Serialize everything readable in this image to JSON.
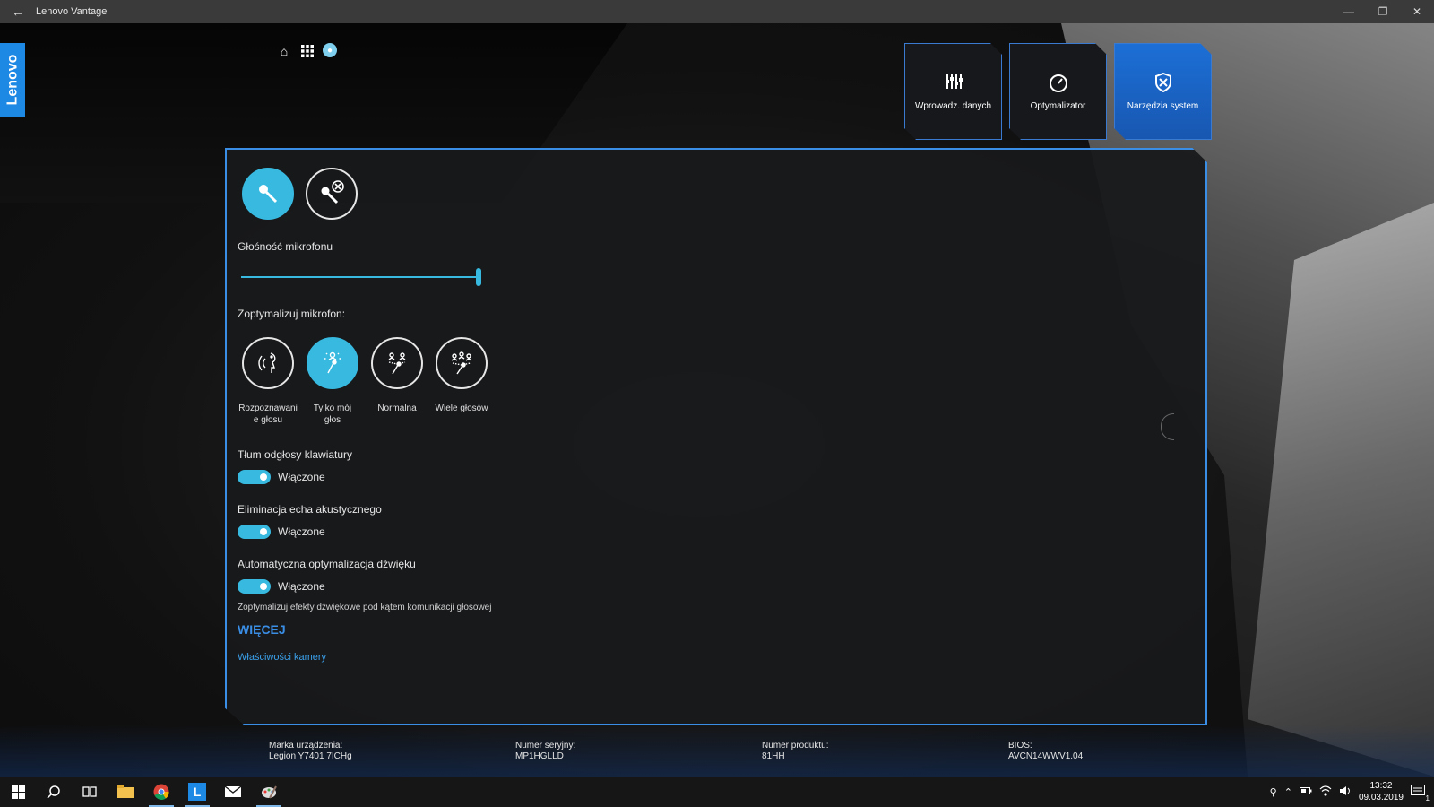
{
  "window": {
    "title": "Lenovo Vantage",
    "back_icon": "arrow-left-icon",
    "controls": [
      "—",
      "❐",
      "✕"
    ]
  },
  "brand": {
    "logo_text": "Lenovo"
  },
  "top_icons": [
    "home-icon",
    "apps-grid-icon",
    "user-icon"
  ],
  "nav_tiles": [
    {
      "label": "Wprowadz. danych",
      "icon": "input-sliders-icon",
      "active": false
    },
    {
      "label": "Optymalizator",
      "icon": "speedometer-icon",
      "active": false
    },
    {
      "label": "Narzędzia system",
      "icon": "tools-shield-icon",
      "active": true
    }
  ],
  "microphone": {
    "mic_buttons": [
      {
        "icon": "microphone-icon",
        "active": true
      },
      {
        "icon": "microphone-mute-icon",
        "active": false
      }
    ],
    "volume_label": "Głośność mikrofonu",
    "volume_value": 100,
    "optimize_label": "Zoptymalizuj mikrofon:",
    "modes": [
      {
        "label": "Rozpoznawani e głosu",
        "icon": "voice-recognition-icon",
        "active": false
      },
      {
        "label": "Tylko mój głos",
        "icon": "only-my-voice-icon",
        "active": true
      },
      {
        "label": "Normalna",
        "icon": "normal-icon",
        "active": false
      },
      {
        "label": "Wiele głosów",
        "icon": "multiple-voices-icon",
        "active": false
      }
    ],
    "toggles": [
      {
        "title": "Tłum odgłosy klawiatury",
        "state": "Włączone"
      },
      {
        "title": "Eliminacja echa akustycznego",
        "state": "Włączone"
      },
      {
        "title": "Automatyczna optymalizacja dźwięku",
        "state": "Włączone"
      }
    ],
    "note": "Zoptymalizuj efekty dźwiękowe pod kątem komunikacji głosowej",
    "more_label": "WIĘCEJ",
    "camera_link": "Właściwości kamery"
  },
  "device_info": [
    {
      "label": "Marka urządzenia:",
      "value": "Legion Y7401 7ICHg"
    },
    {
      "label": "Numer seryjny:",
      "value": "MP1HGLLD"
    },
    {
      "label": "Numer produktu:",
      "value": "81HH"
    },
    {
      "label": "BIOS:",
      "value": "AVCN14WWV1.04"
    }
  ],
  "taskbar": {
    "time": "13:32",
    "date": "09.03.2019",
    "notification_count": "1",
    "apps": [
      "windows-start-icon",
      "search-icon",
      "task-view-icon",
      "file-explorer-icon",
      "chrome-icon",
      "lenovo-vantage-icon",
      "mail-icon",
      "paint-icon"
    ]
  },
  "colors": {
    "accent": "#37b9e0",
    "tile_active": "#1c6fd6",
    "border": "#3a8ee6"
  }
}
